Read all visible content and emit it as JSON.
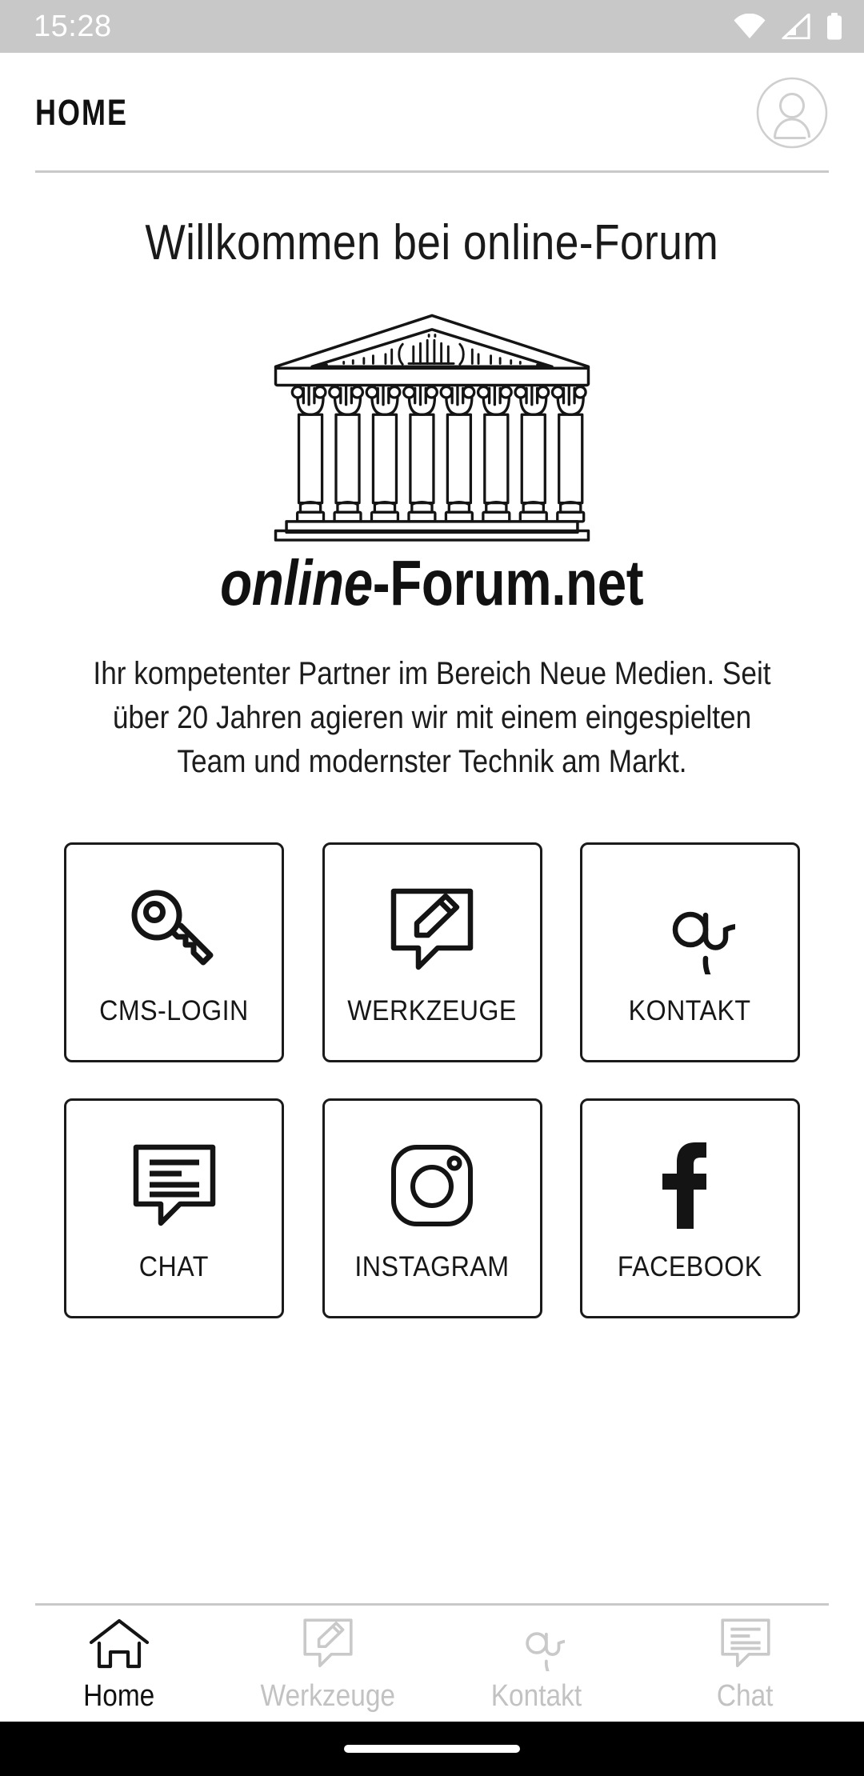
{
  "status_bar": {
    "time": "15:28",
    "icons": [
      "wifi-icon",
      "cellular-signal-icon",
      "battery-icon"
    ],
    "background_color": "#c8c8c8",
    "foreground_color": "#ffffff"
  },
  "header": {
    "title": "HOME",
    "avatar_icon": "user-avatar-icon",
    "divider_color": "#c9c9c9"
  },
  "main": {
    "welcome_heading": "Willkommen bei online-Forum",
    "logo_icon": "greek-temple-icon",
    "brand": {
      "italic_part": "online",
      "regular_part": "-Forum.net"
    },
    "tagline": "Ihr kompetenter Partner im Bereich Neue Medien. Seit über 20 Jahren agieren wir mit einem eingespielten Team und modernster Technik am Markt.",
    "tiles": [
      {
        "label": "CMS-LOGIN",
        "icon": "key-icon"
      },
      {
        "label": "WERKZEUGE",
        "icon": "speech-bubble-pencil-icon"
      },
      {
        "label": "KONTAKT",
        "icon": "at-sign-icon"
      },
      {
        "label": "CHAT",
        "icon": "speech-bubble-lines-icon"
      },
      {
        "label": "INSTAGRAM",
        "icon": "instagram-icon"
      },
      {
        "label": "FACEBOOK",
        "icon": "facebook-icon"
      }
    ]
  },
  "bottom_nav": {
    "active_index": 0,
    "active_color": "#111111",
    "inactive_color": "#c2c2c2",
    "items": [
      {
        "label": "Home",
        "icon": "home-icon"
      },
      {
        "label": "Werkzeuge",
        "icon": "speech-bubble-pencil-icon"
      },
      {
        "label": "Kontakt",
        "icon": "at-sign-icon"
      },
      {
        "label": "Chat",
        "icon": "speech-bubble-lines-icon"
      }
    ]
  },
  "gesture_bar": {
    "background_color": "#000000",
    "pill_color": "#ffffff"
  }
}
